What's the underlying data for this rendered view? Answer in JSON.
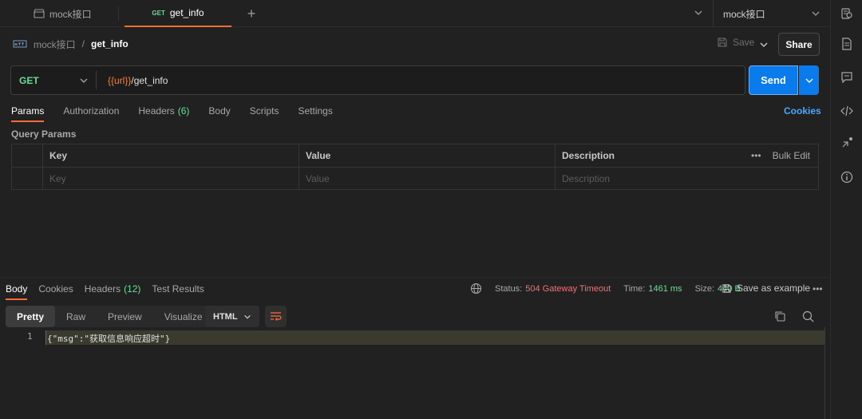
{
  "tabs": {
    "collection_tab": "mock接口",
    "request_tab": {
      "method": "GET",
      "name": "get_info"
    },
    "new_tab_symbol": "+"
  },
  "environment": {
    "selected": "mock接口"
  },
  "breadcrumb": {
    "collection": "mock接口",
    "separator": "/",
    "request": "get_info"
  },
  "toolbar": {
    "save_label": "Save",
    "share_label": "Share"
  },
  "request": {
    "method": "GET",
    "url_variable": "{{url}}",
    "url_path": "/get_info",
    "send_label": "Send"
  },
  "request_tabs": [
    {
      "label": "Params",
      "count": ""
    },
    {
      "label": "Authorization",
      "count": ""
    },
    {
      "label": "Headers",
      "count": "(6)"
    },
    {
      "label": "Body",
      "count": ""
    },
    {
      "label": "Scripts",
      "count": ""
    },
    {
      "label": "Settings",
      "count": ""
    }
  ],
  "cookies_link": "Cookies",
  "query_params": {
    "title": "Query Params",
    "columns": [
      "Key",
      "Value",
      "Description"
    ],
    "bulk_more": "•••",
    "bulk_edit": "Bulk Edit",
    "placeholders": [
      "Key",
      "Value",
      "Description"
    ]
  },
  "response": {
    "tabs": [
      {
        "label": "Body",
        "count": ""
      },
      {
        "label": "Cookies",
        "count": ""
      },
      {
        "label": "Headers",
        "count": "(12)"
      },
      {
        "label": "Test Results",
        "count": ""
      }
    ],
    "status_label": "Status:",
    "status_value": "504 Gateway Timeout",
    "time_label": "Time:",
    "time_value": "1461 ms",
    "size_label": "Size:",
    "size_value": "440 B",
    "save_example": "Save as example",
    "more": "•••",
    "view_modes": [
      "Pretty",
      "Raw",
      "Preview",
      "Visualize"
    ],
    "format": "HTML",
    "line_number": "1",
    "body_text": "{\"msg\":\"获取信息响应超时\"}"
  },
  "colors": {
    "accent": "#ff6c37",
    "send": "#097bed",
    "get_method": "#6bdd9a",
    "error": "#f07178",
    "link": "#4aa8ff"
  }
}
